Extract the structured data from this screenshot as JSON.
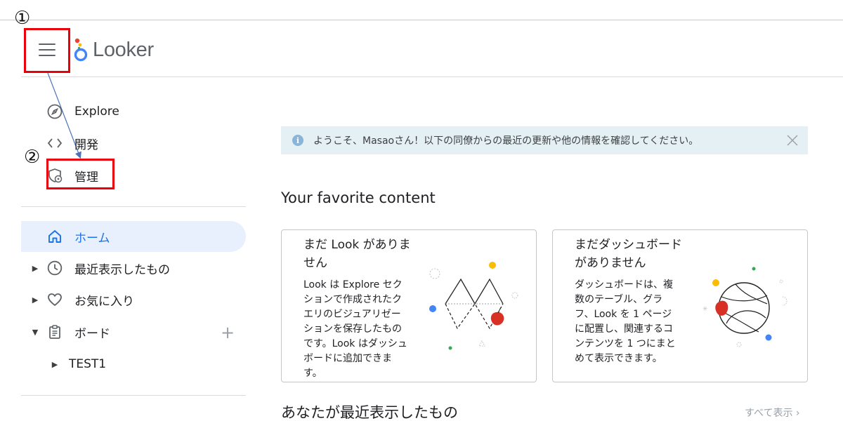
{
  "annotations": {
    "marker_1": "①",
    "marker_2": "②"
  },
  "header": {
    "logo_text": "Looker"
  },
  "admin_menu": {
    "items": [
      {
        "label": "Explore",
        "icon": "compass-icon"
      },
      {
        "label": "開発",
        "icon": "code-icon"
      },
      {
        "label": "管理",
        "icon": "shield-gear-icon"
      }
    ]
  },
  "nav": {
    "home": "ホーム",
    "recent": "最近表示したもの",
    "favorites": "お気に入り",
    "boards": "ボード",
    "board_item": "TEST1"
  },
  "banner": {
    "text": "ようこそ、Masaoさん！以下の同僚からの最近の更新や他の情報を確認してください。"
  },
  "main": {
    "favorites_title": "Your favorite content",
    "recent_title": "あなたが最近表示したもの",
    "see_all": "すべて表示 ›"
  },
  "cards": {
    "look": {
      "title": "まだ Look がありません",
      "body": "Look は Explore セクションで作成されたクエリのビジュアリゼーションを保存したものです。Look はダッシュボードに追加できます。"
    },
    "dashboard": {
      "title": "まだダッシュボードがありません",
      "body": "ダッシュボードは、複数のテーブル、グラフ、Look を 1 ページに配置し、関連するコンテンツを 1 つにまとめて表示できます。"
    }
  },
  "colors": {
    "accent": "#1a73e8",
    "annotation_red": "#e8000b",
    "active_bg": "#e8f0fe",
    "banner_bg": "#e4f0f3"
  }
}
